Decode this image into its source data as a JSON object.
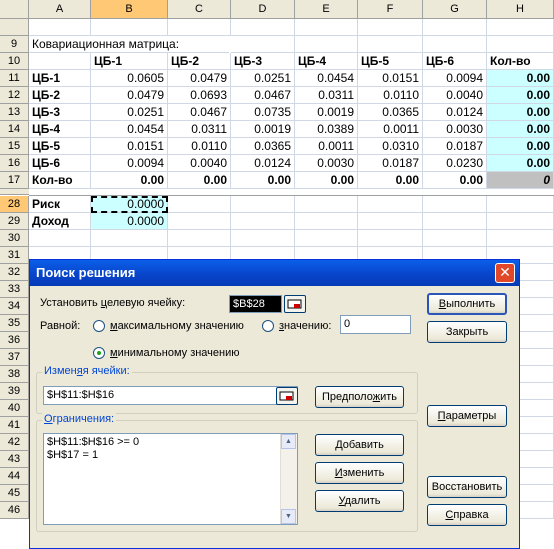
{
  "columns": [
    "A",
    "B",
    "C",
    "D",
    "E",
    "F",
    "G",
    "H"
  ],
  "rows_upper": [
    "9",
    "10",
    "11",
    "12",
    "13",
    "14",
    "15",
    "16",
    "17"
  ],
  "rows_lower": [
    "28",
    "29",
    "30",
    "31",
    "32",
    "33",
    "34",
    "35",
    "36",
    "37",
    "38",
    "39",
    "40",
    "41",
    "42",
    "43",
    "44",
    "45",
    "46"
  ],
  "sheet": {
    "title": "Ковариационная матрица:",
    "col_headers": [
      "ЦБ-1",
      "ЦБ-2",
      "ЦБ-3",
      "ЦБ-4",
      "ЦБ-5",
      "ЦБ-6",
      "Кол-во"
    ],
    "matrix": [
      {
        "label": "ЦБ-1",
        "values": [
          "0.0605",
          "0.0479",
          "0.0251",
          "0.0454",
          "0.0151",
          "0.0094"
        ],
        "qty": "0.00"
      },
      {
        "label": "ЦБ-2",
        "values": [
          "0.0479",
          "0.0693",
          "0.0467",
          "0.0311",
          "0.0110",
          "0.0040"
        ],
        "qty": "0.00"
      },
      {
        "label": "ЦБ-3",
        "values": [
          "0.0251",
          "0.0467",
          "0.0735",
          "0.0019",
          "0.0365",
          "0.0124"
        ],
        "qty": "0.00"
      },
      {
        "label": "ЦБ-4",
        "values": [
          "0.0454",
          "0.0311",
          "0.0019",
          "0.0389",
          "0.0011",
          "0.0030"
        ],
        "qty": "0.00"
      },
      {
        "label": "ЦБ-5",
        "values": [
          "0.0151",
          "0.0110",
          "0.0365",
          "0.0011",
          "0.0310",
          "0.0187"
        ],
        "qty": "0.00"
      },
      {
        "label": "ЦБ-6",
        "values": [
          "0.0094",
          "0.0040",
          "0.0124",
          "0.0030",
          "0.0187",
          "0.0230"
        ],
        "qty": "0.00"
      }
    ],
    "total_row": {
      "label": "Кол-во",
      "values": [
        "0.00",
        "0.00",
        "0.00",
        "0.00",
        "0.00",
        "0.00"
      ],
      "qty": "0"
    },
    "risk": {
      "label": "Риск",
      "value": "0.0000"
    },
    "income": {
      "label": "Доход",
      "value": "0.0000"
    }
  },
  "dialog": {
    "title": "Поиск решения",
    "close": "✕",
    "target_label_pre": "Установить ",
    "target_label_u": "ц",
    "target_label_post": "елевую ячейку:",
    "target_value": "$B$28",
    "equal_label": "Равной:",
    "opt_max_u": "м",
    "opt_max": "аксимальному значению",
    "opt_value_u": "з",
    "opt_value": "начению:",
    "value_field": "0",
    "opt_min_u": "м",
    "opt_min": "инимальному значению",
    "changing_label_pre": "Измен",
    "changing_label_u": "я",
    "changing_label_post": "я ячейки:",
    "changing_value": "$H$11:$H$16",
    "guess_pre": "Предполо",
    "guess_u": "ж",
    "guess_post": "ить",
    "constraints_label_pre": "",
    "constraints_label_u": "О",
    "constraints_label_post": "граничения:",
    "constraints": [
      "$H$11:$H$16 >= 0",
      "$H$17 = 1"
    ],
    "add_pre": "",
    "add_u": "Д",
    "add_post": "обавить",
    "change_pre": "",
    "change_u": "И",
    "change_post": "зменить",
    "delete_pre": "",
    "delete_u": "У",
    "delete_post": "далить",
    "solve_pre": "",
    "solve_u": "В",
    "solve_post": "ыполнить",
    "close_btn_pre": "Закрыть",
    "params_pre": "",
    "params_u": "П",
    "params_post": "араметры",
    "reset_pre": "Восстановить",
    "help_pre": "",
    "help_u": "С",
    "help_post": "правка"
  }
}
